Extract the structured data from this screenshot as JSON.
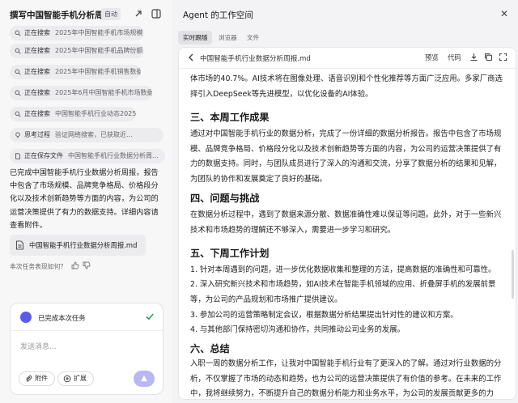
{
  "left": {
    "title": "撰写中国智能手机分析周报",
    "auto_badge": "自动",
    "steps": [
      {
        "action": "正在搜索",
        "text": "2025年中国智能手机市场规模"
      },
      {
        "action": "正在搜索",
        "text": "2025年中国智能手机品牌份额"
      },
      {
        "action": "正在搜索",
        "text": "2025年中国智能手机销售数据"
      },
      {
        "action": "正在搜索",
        "text": "2025年6月中国智能手机市场数据"
      },
      {
        "action": "正在搜索",
        "text": "中国智能手机行业动态2025"
      },
      {
        "action": "思考过程",
        "text": "验证网络搜索，已获取近..."
      },
      {
        "action": "正在保存文件",
        "text": "中国智能手机行业数据分析周..."
      }
    ],
    "summary": "已完成中国智能手机行业数据分析周报，报告中包含了市场规模、品牌竞争格局、价格段分化以及技术创新趋势等方面的内容，为公司的运营决策提供了有力的数据支持。详细内容请查看附件。",
    "file_name": "中国智能手机行业数据分析周报.md",
    "feedback_prompt": "本次任务表现如何？",
    "task_done": "已完成本次任务",
    "input_placeholder": "发送消息...",
    "attach_label": "附件",
    "extend_label": "扩展"
  },
  "workspace": {
    "title": "Agent 的工作空间",
    "tabs": [
      "实时跟随",
      "浏览器",
      "文件"
    ],
    "doc_name": "中国智能手机行业数据分析周报.md",
    "preview_label": "预览",
    "code_label": "代码"
  },
  "doc": {
    "intro_tail": "体市场的40.7%。AI技术将在图像处理、语音识别和个性化推荐等方面广泛应用。多家厂商选择引入DeepSeek等先进模型，以优化设备的AI体验。",
    "h3": "三、本周工作成果",
    "p3": "通过对中国智能手机行业的数据分析，完成了一份详细的数据分析报告。报告中包含了市场规模、品牌竞争格局、价格段分化以及技术创新趋势等方面的内容，为公司的运营决策提供了有力的数据支持。同时，与团队成员进行了深入的沟通和交流，分享了数据分析的结果和见解，为团队的协作和发展奠定了良好的基础。",
    "h4": "四、问题与挑战",
    "p4": "在数据分析过程中，遇到了数据来源分散、数据准确性难以保证等问题。此外，对于一些新兴技术和市场趋势的理解还不够深入，需要进一步学习和研究。",
    "h5": "五、下周工作计划",
    "plan": [
      "1. 针对本周遇到的问题，进一步优化数据收集和整理的方法，提高数据的准确性和可靠性。",
      "2. 深入研究新兴技术和市场趋势，如AI技术在智能手机领域的应用、折叠屏手机的发展前景等，为公司的产品规划和市场推广提供建议。",
      "3. 参加公司的运营策略制定会议，根据数据分析结果提出针对性的建议和方案。",
      "4. 与其他部门保持密切沟通和协作，共同推动公司业务的发展。"
    ],
    "h6": "六、总结",
    "p6": "入职一周的数据分析工作，让我对中国智能手机行业有了更深入的了解。通过对行业数据的分析，不仅掌握了市场的动态和趋势，也为公司的运营决策提供了有价值的参考。在未来的工作中，我将继续努力，不断提升自己的数据分析能力和业务水平，为公司的发展贡献更多的力量。"
  }
}
